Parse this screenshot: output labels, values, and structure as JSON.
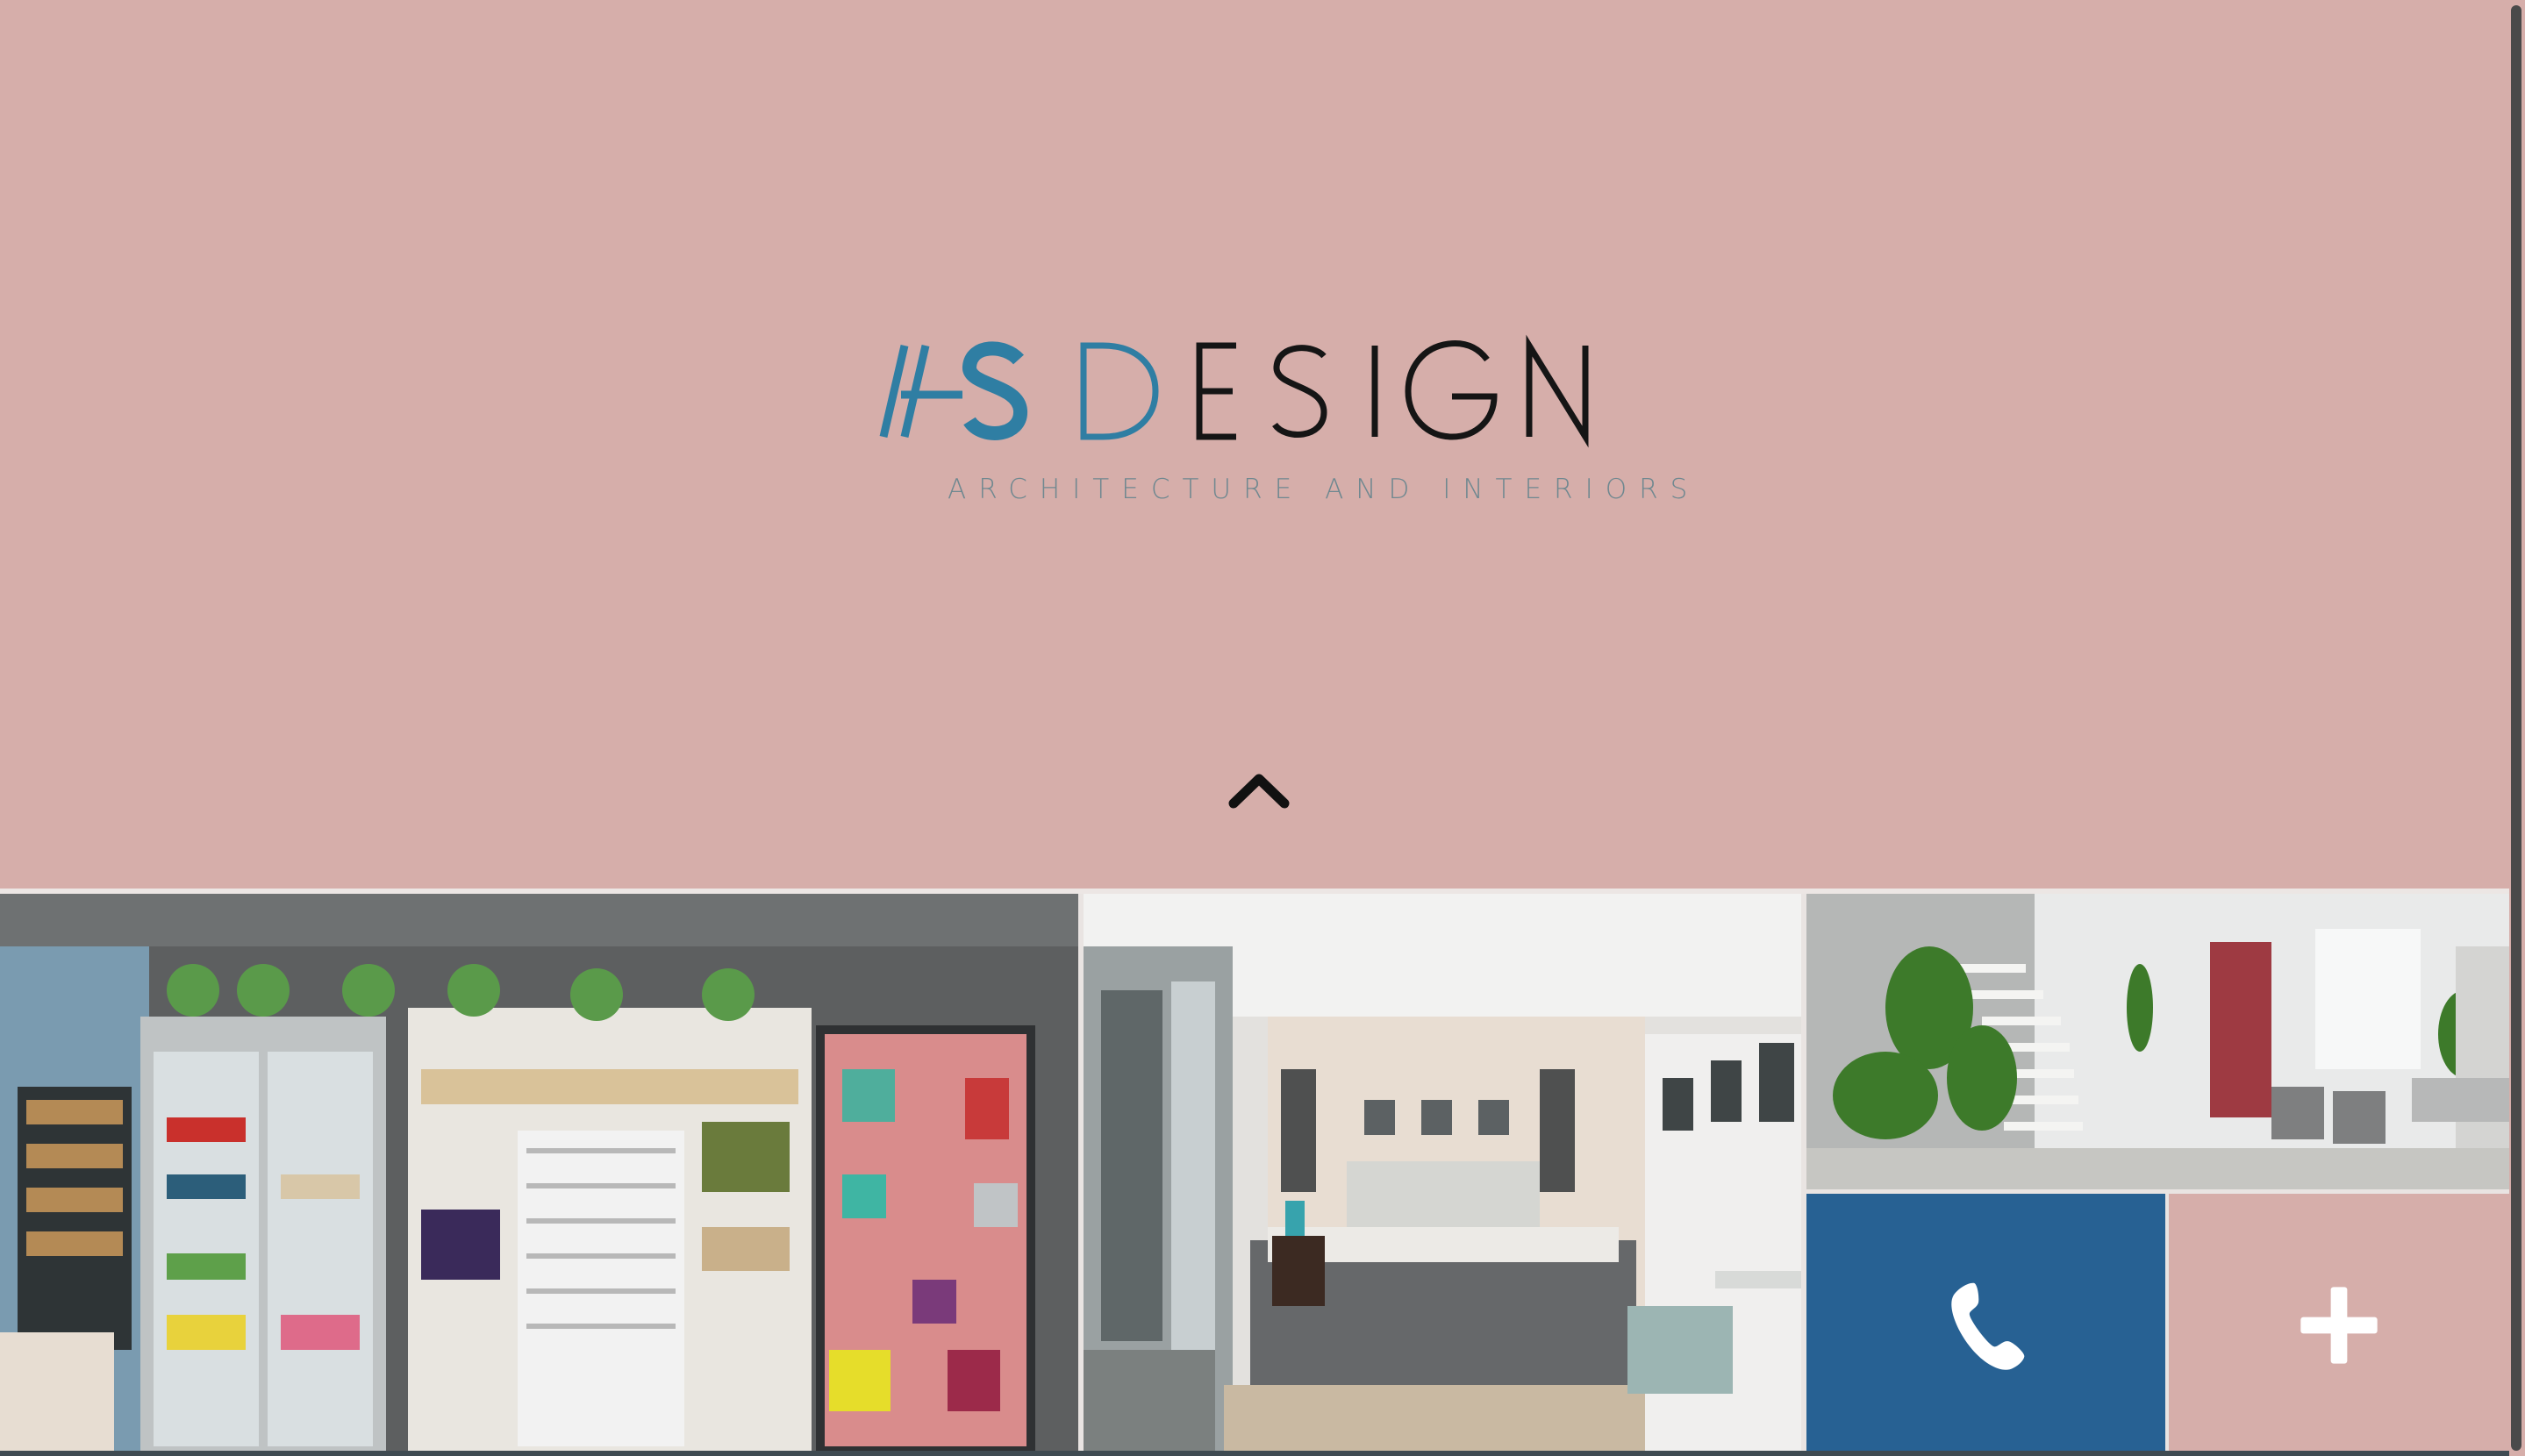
{
  "hero": {
    "logo_text": "ASDESIGN",
    "tagline": "ARCHITECTURE AND INTERIORS",
    "scroll_up_icon": "chevron-up-icon",
    "background_color": "#d6aeaa"
  },
  "gallery": {
    "tiles": [
      {
        "name": "pantry-shelving-render"
      },
      {
        "name": "bedroom-render"
      },
      {
        "name": "staircase-living-room-render"
      }
    ]
  },
  "actions": {
    "call_icon": "phone-icon",
    "call_color": "#276193",
    "more_icon": "plus-icon",
    "more_color": "#d6aeaa"
  },
  "colors": {
    "logo_blue": "#2f7ea3",
    "logo_black": "#151515",
    "tagline": "#6f8890"
  }
}
